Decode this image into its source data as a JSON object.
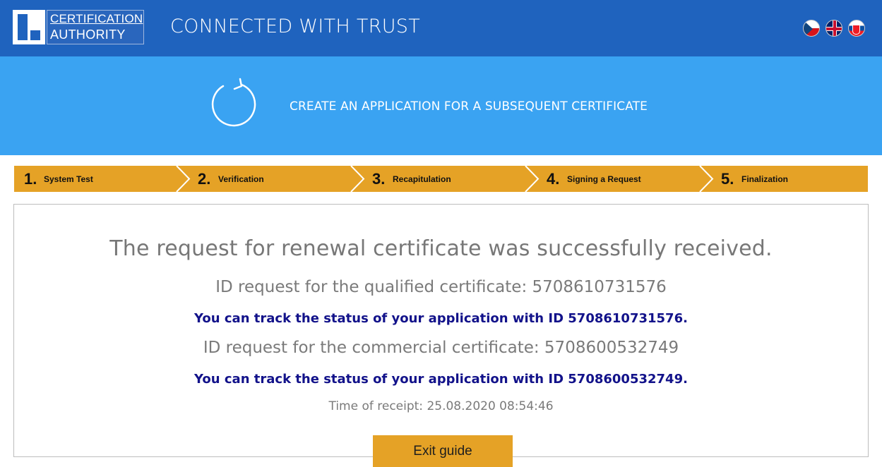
{
  "header": {
    "logo_line1": "CERTIFICATION",
    "logo_line2": "AUTHORITY",
    "tagline": "CONNECTED WITH TRUST",
    "languages": [
      "cz-flag-icon",
      "uk-flag-icon",
      "sk-flag-icon"
    ]
  },
  "hero": {
    "icon": "renew-icon",
    "title": "CREATE AN APPLICATION FOR A SUBSEQUENT CERTIFICATE"
  },
  "steps": [
    {
      "number": "1.",
      "label": "System Test"
    },
    {
      "number": "2.",
      "label": "Verification"
    },
    {
      "number": "3.",
      "label": "Recapitulation"
    },
    {
      "number": "4.",
      "label": "Signing a Request"
    },
    {
      "number": "5.",
      "label": "Finalization"
    }
  ],
  "result": {
    "title": "The request for renewal certificate was successfully received.",
    "qualified_id": "ID request for the qualified certificate: 5708610731576",
    "qualified_track": "You can track the status of your application with ID 5708610731576.",
    "commercial_id": "ID request for the commercial certificate: 5708600532749",
    "commercial_track": "You can track the status of your application with ID 5708600532749.",
    "time_of_receipt": "Time of receipt: 25.08.2020 08:54:46"
  },
  "actions": {
    "exit_label": "Exit guide"
  },
  "colors": {
    "topbar": "#1f63be",
    "hero": "#3aa3f2",
    "accent": "#e5a226",
    "track_text": "#12128a",
    "muted_text": "#777777"
  }
}
